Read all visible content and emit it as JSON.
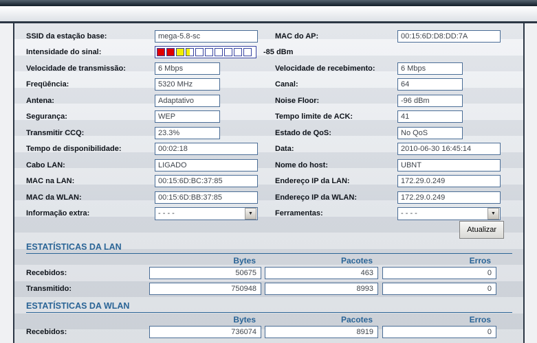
{
  "colors": {
    "accent_blue": "#2a6496",
    "panel_border": "#2b3644",
    "input_border": "#4a6d96",
    "bar_red": "#e00000",
    "bar_yellow": "#f2ee00"
  },
  "signal": {
    "label": "Intensidade do sinal:",
    "dbm": "-85 dBm",
    "bars": [
      "full-red",
      "full-red",
      "full-yellow",
      "half-yellow",
      "empty",
      "empty",
      "empty",
      "empty",
      "empty",
      "empty"
    ]
  },
  "form": {
    "left": [
      {
        "label": "SSID da estação base:",
        "value": "mega-5.8-sc"
      },
      {
        "label": "Velocidade de transmissão:",
        "value": "6 Mbps"
      },
      {
        "label": "Freqüência:",
        "value": "5320 MHz"
      },
      {
        "label": "Antena:",
        "value": "Adaptativo"
      },
      {
        "label": "Segurança:",
        "value": "WEP"
      },
      {
        "label": "Transmitir CCQ:",
        "value": "23.3%"
      },
      {
        "label": "Tempo de disponibilidade:",
        "value": "00:02:18"
      },
      {
        "label": "Cabo LAN:",
        "value": "LIGADO"
      },
      {
        "label": "MAC na LAN:",
        "value": "00:15:6D:BC:37:85"
      },
      {
        "label": "MAC da WLAN:",
        "value": "00:15:6D:BB:37:85"
      },
      {
        "label": "Informação extra:",
        "value": "- - - -"
      }
    ],
    "right": [
      {
        "label": "MAC do AP:",
        "value": "00:15:6D:D8:DD:7A"
      },
      {
        "label": "Velocidade de recebimento:",
        "value": "6 Mbps"
      },
      {
        "label": "Canal:",
        "value": "64"
      },
      {
        "label": "Noise Floor:",
        "value": "-96 dBm"
      },
      {
        "label": "Tempo limite de ACK:",
        "value": "41"
      },
      {
        "label": "Estado de QoS:",
        "value": "No QoS"
      },
      {
        "label": "Data:",
        "value": "2010-06-30 16:45:14"
      },
      {
        "label": "Nome do host:",
        "value": "UBNT"
      },
      {
        "label": "Endereço IP da LAN:",
        "value": "172.29.0.249"
      },
      {
        "label": "Endereço IP da WLAN:",
        "value": "172.29.0.249"
      },
      {
        "label": "Ferramentas:",
        "value": "- - - -"
      }
    ]
  },
  "buttons": {
    "refresh": "Atualizar"
  },
  "lan_stats": {
    "title": "ESTATÍSTICAS DA LAN",
    "headers": {
      "bytes": "Bytes",
      "packets": "Pacotes",
      "errors": "Erros"
    },
    "rows": [
      {
        "label": "Recebidos:",
        "bytes": "50675",
        "packets": "463",
        "errors": "0"
      },
      {
        "label": "Transmitido:",
        "bytes": "750948",
        "packets": "8993",
        "errors": "0"
      }
    ]
  },
  "wlan_stats": {
    "title": "ESTATÍSTICAS DA WLAN",
    "headers": {
      "bytes": "Bytes",
      "packets": "Pacotes",
      "errors": "Erros"
    },
    "rows": [
      {
        "label": "Recebidos:",
        "bytes": "736074",
        "packets": "8919",
        "errors": "0"
      }
    ]
  }
}
